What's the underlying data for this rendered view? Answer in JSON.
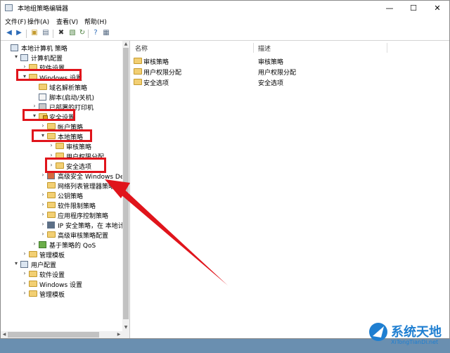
{
  "window": {
    "title": "本地组策略编辑器",
    "minimize": "—",
    "maximize": "☐",
    "close": "✕"
  },
  "menu": [
    "文件(F)",
    "操作(A)",
    "查看(V)",
    "帮助(H)"
  ],
  "tree": [
    {
      "label": "本地计算机 策略",
      "level": 0,
      "arrow": "",
      "icon": "computer-icon"
    },
    {
      "label": "计算机配置",
      "level": 1,
      "arrow": "▾",
      "icon": "computer-config-icon"
    },
    {
      "label": "软件设置",
      "level": 2,
      "arrow": "›",
      "icon": "folder-icon"
    },
    {
      "label": "Windows 设置",
      "level": 2,
      "arrow": "▾",
      "icon": "folder-icon"
    },
    {
      "label": "域名解析策略",
      "level": 3,
      "arrow": "",
      "icon": "folder-icon"
    },
    {
      "label": "脚本(启动/关机)",
      "level": 3,
      "arrow": "",
      "icon": "script-icon"
    },
    {
      "label": "已部署的打印机",
      "level": 3,
      "arrow": "›",
      "icon": "printer-icon"
    },
    {
      "label": "安全设置",
      "level": 3,
      "arrow": "▾",
      "icon": "security-folder-icon"
    },
    {
      "label": "帐户策略",
      "level": 4,
      "arrow": "›",
      "icon": "folder-icon"
    },
    {
      "label": "本地策略",
      "level": 4,
      "arrow": "▾",
      "icon": "folder-icon"
    },
    {
      "label": "审核策略",
      "level": 5,
      "arrow": "›",
      "icon": "folder-icon"
    },
    {
      "label": "用户权限分配",
      "level": 5,
      "arrow": "›",
      "icon": "folder-icon"
    },
    {
      "label": "安全选项",
      "level": 5,
      "arrow": "›",
      "icon": "folder-icon"
    },
    {
      "label": "高级安全 Windows Defender",
      "level": 4,
      "arrow": "›",
      "icon": "firewall-icon"
    },
    {
      "label": "网络列表管理器策略",
      "level": 4,
      "arrow": "",
      "icon": "folder-icon"
    },
    {
      "label": "公钥策略",
      "level": 4,
      "arrow": "›",
      "icon": "folder-icon"
    },
    {
      "label": "软件限制策略",
      "level": 4,
      "arrow": "›",
      "icon": "folder-icon"
    },
    {
      "label": "应用程序控制策略",
      "level": 4,
      "arrow": "›",
      "icon": "folder-icon"
    },
    {
      "label": "IP 安全策略，在 本地计算机",
      "level": 4,
      "arrow": "›",
      "icon": "ip-security-icon"
    },
    {
      "label": "高级审核策略配置",
      "level": 4,
      "arrow": "›",
      "icon": "folder-icon"
    },
    {
      "label": "基于策略的 QoS",
      "level": 3,
      "arrow": "›",
      "icon": "qos-chart-icon"
    },
    {
      "label": "管理模板",
      "level": 2,
      "arrow": "›",
      "icon": "folder-icon"
    },
    {
      "label": "用户配置",
      "level": 1,
      "arrow": "▾",
      "icon": "user-config-icon"
    },
    {
      "label": "软件设置",
      "level": 2,
      "arrow": "›",
      "icon": "folder-icon"
    },
    {
      "label": "Windows 设置",
      "level": 2,
      "arrow": "›",
      "icon": "folder-icon"
    },
    {
      "label": "管理模板",
      "level": 2,
      "arrow": "›",
      "icon": "folder-icon"
    }
  ],
  "columns": {
    "name": "名称",
    "description": "描述"
  },
  "items": [
    {
      "name": "审核策略",
      "description": "审核策略"
    },
    {
      "name": "用户权限分配",
      "description": "用户权限分配"
    },
    {
      "name": "安全选项",
      "description": "安全选项"
    }
  ],
  "watermark": {
    "title": "系统天地",
    "url": "XiTongTianDi.net"
  },
  "colors": {
    "annotation_red": "#e0141b",
    "folder": "#f2cf73"
  }
}
